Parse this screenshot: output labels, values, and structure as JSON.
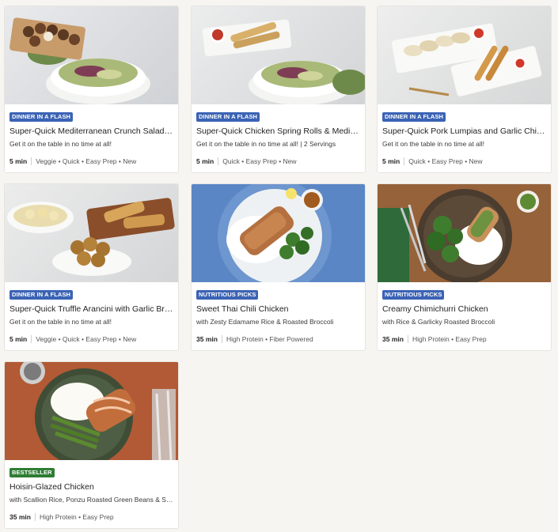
{
  "colors": {
    "badge_flash": "#3b63b5",
    "badge_nutritious": "#3b63b5",
    "badge_bestseller": "#2e7d32",
    "page_bg": "#f6f5f1"
  },
  "cards": [
    {
      "badge": "DINNER IN A FLASH",
      "badge_color": "#3b63b5",
      "title": "Super-Quick Mediterranean Crunch Salad with Chicken Bites",
      "subtitle": "Get it on the table in no time at all!",
      "time": "5 min",
      "tags": "Veggie • Quick • Easy Prep • New",
      "image": "salad-and-bites"
    },
    {
      "badge": "DINNER IN A FLASH",
      "badge_color": "#3b63b5",
      "title": "Super-Quick Chicken Spring Rolls & Mediterranean Salad",
      "subtitle": "Get it on the table in no time at all! | 2 Servings",
      "time": "5 min",
      "tags": "Quick • Easy Prep • New",
      "image": "spring-rolls-salad"
    },
    {
      "badge": "DINNER IN A FLASH",
      "badge_color": "#3b63b5",
      "title": "Super-Quick Pork Lumpias and Garlic Chicken Potstickers",
      "subtitle": "Get it on the table in no time at all!",
      "time": "5 min",
      "tags": "Quick • Easy Prep • New",
      "image": "lumpias-potstickers"
    },
    {
      "badge": "DINNER IN A FLASH",
      "badge_color": "#3b63b5",
      "title": "Super-Quick Truffle Arancini with Garlic Bread & Ravioli",
      "subtitle": "Get it on the table in no time at all!",
      "time": "5 min",
      "tags": "Veggie • Quick • Easy Prep • New",
      "image": "arancini-garlic-bread"
    },
    {
      "badge": "NUTRITIOUS PICKS",
      "badge_color": "#3b63b5",
      "title": "Sweet Thai Chili Chicken",
      "subtitle": "with Zesty Edamame Rice & Roasted Broccoli",
      "time": "35 min",
      "tags": "High Protein • Fiber Powered",
      "image": "thai-chili-chicken"
    },
    {
      "badge": "NUTRITIOUS PICKS",
      "badge_color": "#3b63b5",
      "title": "Creamy Chimichurri Chicken",
      "subtitle": "with Rice & Garlicky Roasted Broccoli",
      "time": "35 min",
      "tags": "High Protein • Easy Prep",
      "image": "chimichurri-chicken"
    },
    {
      "badge": "BESTSELLER",
      "badge_color": "#2e7d32",
      "title": "Hoisin-Glazed Chicken",
      "subtitle": "with Scallion Rice, Ponzu Roasted Green Beans & Sriracha Mayo",
      "time": "35 min",
      "tags": "High Protein • Easy Prep",
      "image": "hoisin-chicken"
    }
  ]
}
